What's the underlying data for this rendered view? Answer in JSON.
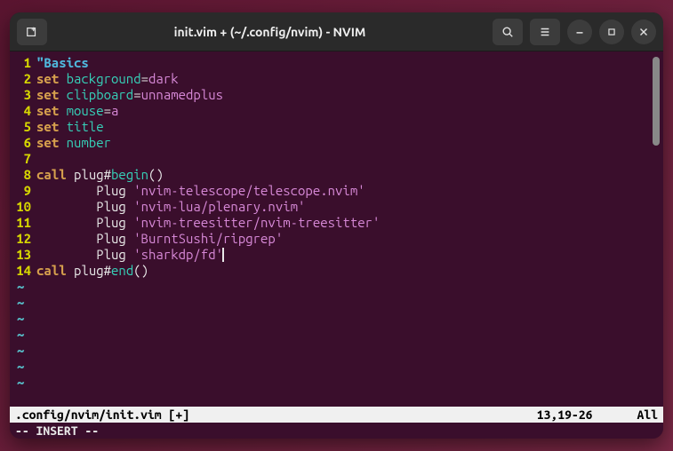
{
  "window": {
    "title": "init.vim + (~/.config/nvim) - NVIM"
  },
  "statusbar": {
    "file": ".config/nvim/init.vim [+]",
    "position": "13,19-26",
    "percent": "All"
  },
  "modeline": "-- INSERT --",
  "tilde": "~",
  "lines": [
    {
      "n": "1",
      "tokens": [
        {
          "c": "c-comment",
          "t": "\"Basics"
        }
      ]
    },
    {
      "n": "2",
      "tokens": [
        {
          "c": "c-keyword",
          "t": "set"
        },
        {
          "c": "",
          "t": " "
        },
        {
          "c": "c-option",
          "t": "background"
        },
        {
          "c": "c-op",
          "t": "="
        },
        {
          "c": "c-value",
          "t": "dark"
        }
      ]
    },
    {
      "n": "3",
      "tokens": [
        {
          "c": "c-keyword",
          "t": "set"
        },
        {
          "c": "",
          "t": " "
        },
        {
          "c": "c-option",
          "t": "clipboard"
        },
        {
          "c": "c-op",
          "t": "="
        },
        {
          "c": "c-value",
          "t": "unnamedplus"
        }
      ]
    },
    {
      "n": "4",
      "tokens": [
        {
          "c": "c-keyword",
          "t": "set"
        },
        {
          "c": "",
          "t": " "
        },
        {
          "c": "c-option",
          "t": "mouse"
        },
        {
          "c": "c-op",
          "t": "="
        },
        {
          "c": "c-value",
          "t": "a"
        }
      ]
    },
    {
      "n": "5",
      "tokens": [
        {
          "c": "c-keyword",
          "t": "set"
        },
        {
          "c": "",
          "t": " "
        },
        {
          "c": "c-option",
          "t": "title"
        }
      ]
    },
    {
      "n": "6",
      "tokens": [
        {
          "c": "c-keyword",
          "t": "set"
        },
        {
          "c": "",
          "t": " "
        },
        {
          "c": "c-option",
          "t": "number"
        }
      ]
    },
    {
      "n": "7",
      "tokens": []
    },
    {
      "n": "8",
      "tokens": [
        {
          "c": "c-keyword",
          "t": "call"
        },
        {
          "c": "",
          "t": " "
        },
        {
          "c": "c-func",
          "t": "plug#"
        },
        {
          "c": "c-special",
          "t": "begin"
        },
        {
          "c": "c-punct",
          "t": "()"
        }
      ]
    },
    {
      "n": "9",
      "tokens": [
        {
          "c": "",
          "t": "        "
        },
        {
          "c": "c-plug",
          "t": "Plug "
        },
        {
          "c": "c-string",
          "t": "'nvim-telescope/telescope.nvim'"
        }
      ]
    },
    {
      "n": "10",
      "tokens": [
        {
          "c": "",
          "t": "        "
        },
        {
          "c": "c-plug",
          "t": "Plug "
        },
        {
          "c": "c-string",
          "t": "'nvim-lua/plenary.nvim'"
        }
      ]
    },
    {
      "n": "11",
      "tokens": [
        {
          "c": "",
          "t": "        "
        },
        {
          "c": "c-plug",
          "t": "Plug "
        },
        {
          "c": "c-string",
          "t": "'nvim-treesitter/nvim-treesitter'"
        }
      ]
    },
    {
      "n": "12",
      "tokens": [
        {
          "c": "",
          "t": "        "
        },
        {
          "c": "c-plug",
          "t": "Plug "
        },
        {
          "c": "c-string",
          "t": "'BurntSushi/ripgrep'"
        }
      ]
    },
    {
      "n": "13",
      "tokens": [
        {
          "c": "",
          "t": "        "
        },
        {
          "c": "c-plug",
          "t": "Plug "
        },
        {
          "c": "c-string",
          "t": "'sharkdp/fd'"
        }
      ],
      "cursor": true
    },
    {
      "n": "14",
      "tokens": [
        {
          "c": "c-keyword",
          "t": "call"
        },
        {
          "c": "",
          "t": " "
        },
        {
          "c": "c-func",
          "t": "plug#"
        },
        {
          "c": "c-special",
          "t": "end"
        },
        {
          "c": "c-punct",
          "t": "()"
        }
      ]
    }
  ],
  "empty_lines": 7
}
